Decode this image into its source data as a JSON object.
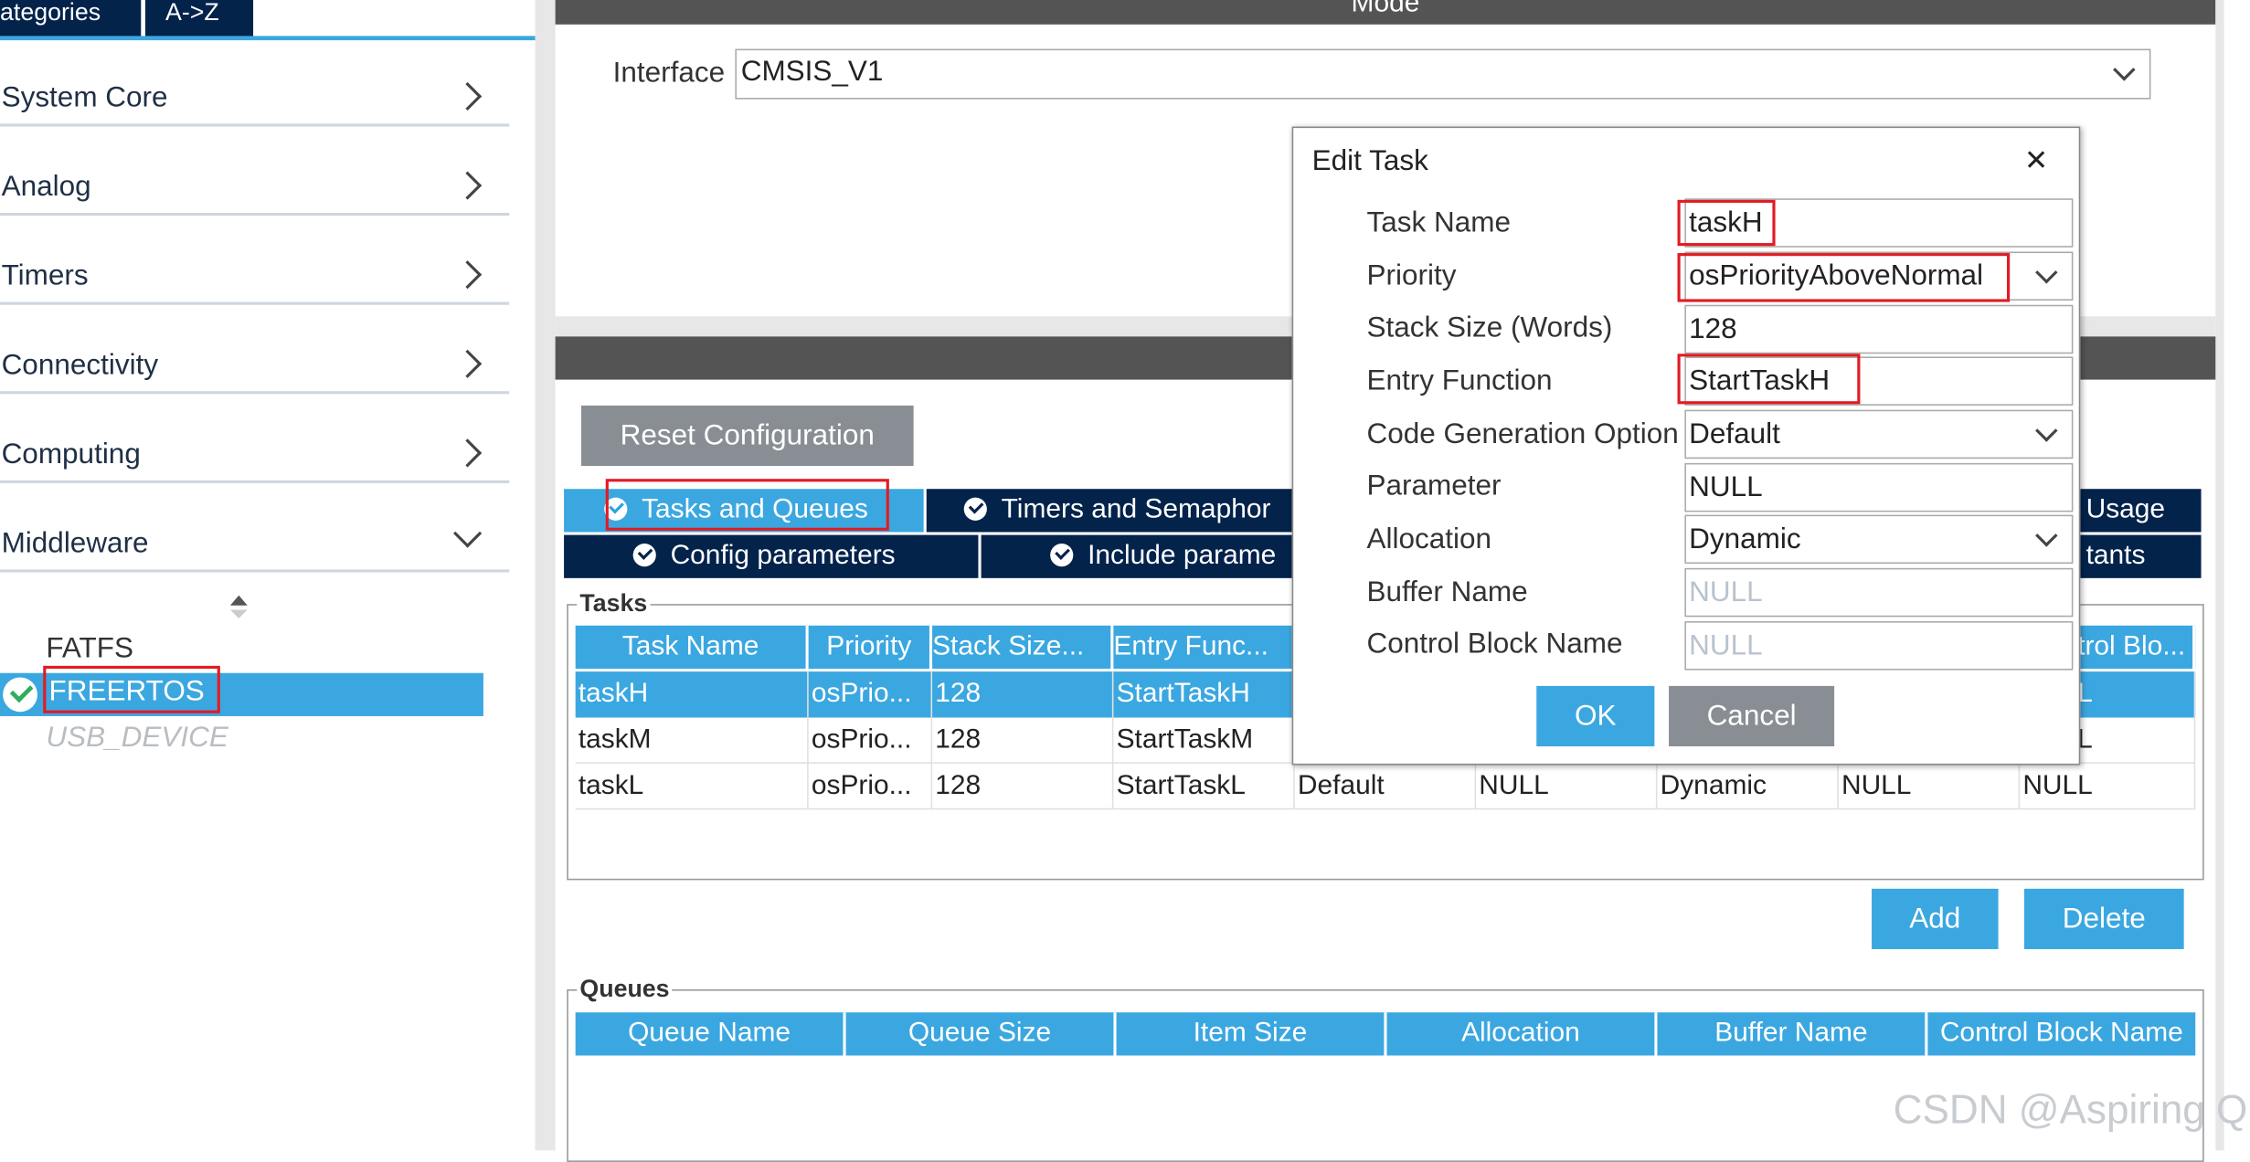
{
  "categories_panel": {
    "tabs": [
      "ategories",
      "A->Z"
    ],
    "items": [
      {
        "label": "System Core"
      },
      {
        "label": "Analog"
      },
      {
        "label": "Timers"
      },
      {
        "label": "Connectivity"
      },
      {
        "label": "Computing"
      },
      {
        "label": "Middleware"
      }
    ],
    "middleware_items": [
      "FATFS",
      "FREERTOS",
      "USB_DEVICE"
    ]
  },
  "mode_section": {
    "header": "Mode",
    "interface_label": "Interface",
    "interface_value": "CMSIS_V1"
  },
  "config_section": {
    "reset_button": "Reset Configuration",
    "tabs_row1": [
      "Tasks and Queues",
      "Timers and Semaphor",
      "Usage"
    ],
    "tabs_row2": [
      "Config parameters",
      "Include parame",
      "tants"
    ]
  },
  "tasks_table": {
    "group_title": "Tasks",
    "columns": [
      "Task Name",
      "Priority",
      "Stack Size...",
      "Entry Func...",
      "",
      "",
      "",
      "",
      "trol Blo..."
    ],
    "rows": [
      [
        "taskH",
        "osPrio...",
        "128",
        "StartTaskH",
        "",
        "",
        "",
        "",
        "L"
      ],
      [
        "taskM",
        "osPrio...",
        "128",
        "StartTaskM",
        "",
        "",
        "",
        "",
        "L"
      ],
      [
        "taskL",
        "osPrio...",
        "128",
        "StartTaskL",
        "Default",
        "NULL",
        "Dynamic",
        "NULL",
        "NULL"
      ]
    ],
    "add_button": "Add",
    "delete_button": "Delete"
  },
  "queues_table": {
    "group_title": "Queues",
    "columns": [
      "Queue Name",
      "Queue Size",
      "Item Size",
      "Allocation",
      "Buffer Name",
      "Control Block Name"
    ]
  },
  "edit_task_dialog": {
    "title": "Edit Task",
    "close_symbol": "✕",
    "fields": [
      {
        "label": "Task Name",
        "value": "taskH"
      },
      {
        "label": "Priority",
        "value": "osPriorityAboveNormal"
      },
      {
        "label": "Stack Size (Words)",
        "value": "128"
      },
      {
        "label": "Entry Function",
        "value": "StartTaskH"
      },
      {
        "label": "Code Generation Option",
        "value": "Default"
      },
      {
        "label": "Parameter",
        "value": "NULL"
      },
      {
        "label": "Allocation",
        "value": "Dynamic"
      },
      {
        "label": "Buffer Name",
        "value": "NULL"
      },
      {
        "label": "Control Block Name",
        "value": "NULL"
      }
    ],
    "ok_button": "OK",
    "cancel_button": "Cancel"
  },
  "watermark": "CSDN @Aspiring Q",
  "colors": {
    "accent": "#3ba7e0",
    "navy": "#03234b",
    "highlight_box": "#e31b23"
  }
}
